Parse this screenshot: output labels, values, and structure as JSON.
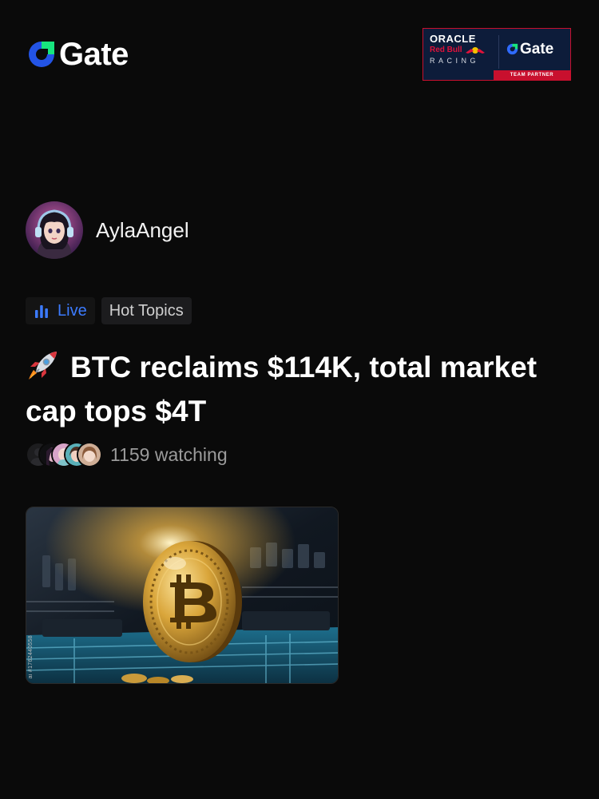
{
  "header": {
    "logo_text": "Gate",
    "logo_icon": "gate-logo-icon",
    "partner": {
      "oracle": "ORACLE",
      "red_bull": "Red Bull",
      "racing": "RACING",
      "gate": "Gate",
      "strip": "TEAM PARTNER"
    }
  },
  "author": {
    "name": "AylaAngel",
    "avatar_icon": "avatar"
  },
  "tags": {
    "live_label": "Live",
    "live_icon": "bar-chart-icon",
    "topic_label": "Hot Topics"
  },
  "post": {
    "title_icon": "rocket-icon",
    "title": "BTC reclaims $114K, total market cap tops $4T"
  },
  "watchers": {
    "text": "1159 watching"
  },
  "media": {
    "stock_id": "ai #1762440558"
  },
  "colors": {
    "background": "#0a0a0a",
    "gate_green": "#17e57e",
    "gate_blue": "#2354e6",
    "live_blue": "#3c7bff",
    "partner_red": "#c8102e",
    "partner_navy": "#0d1c3a"
  }
}
